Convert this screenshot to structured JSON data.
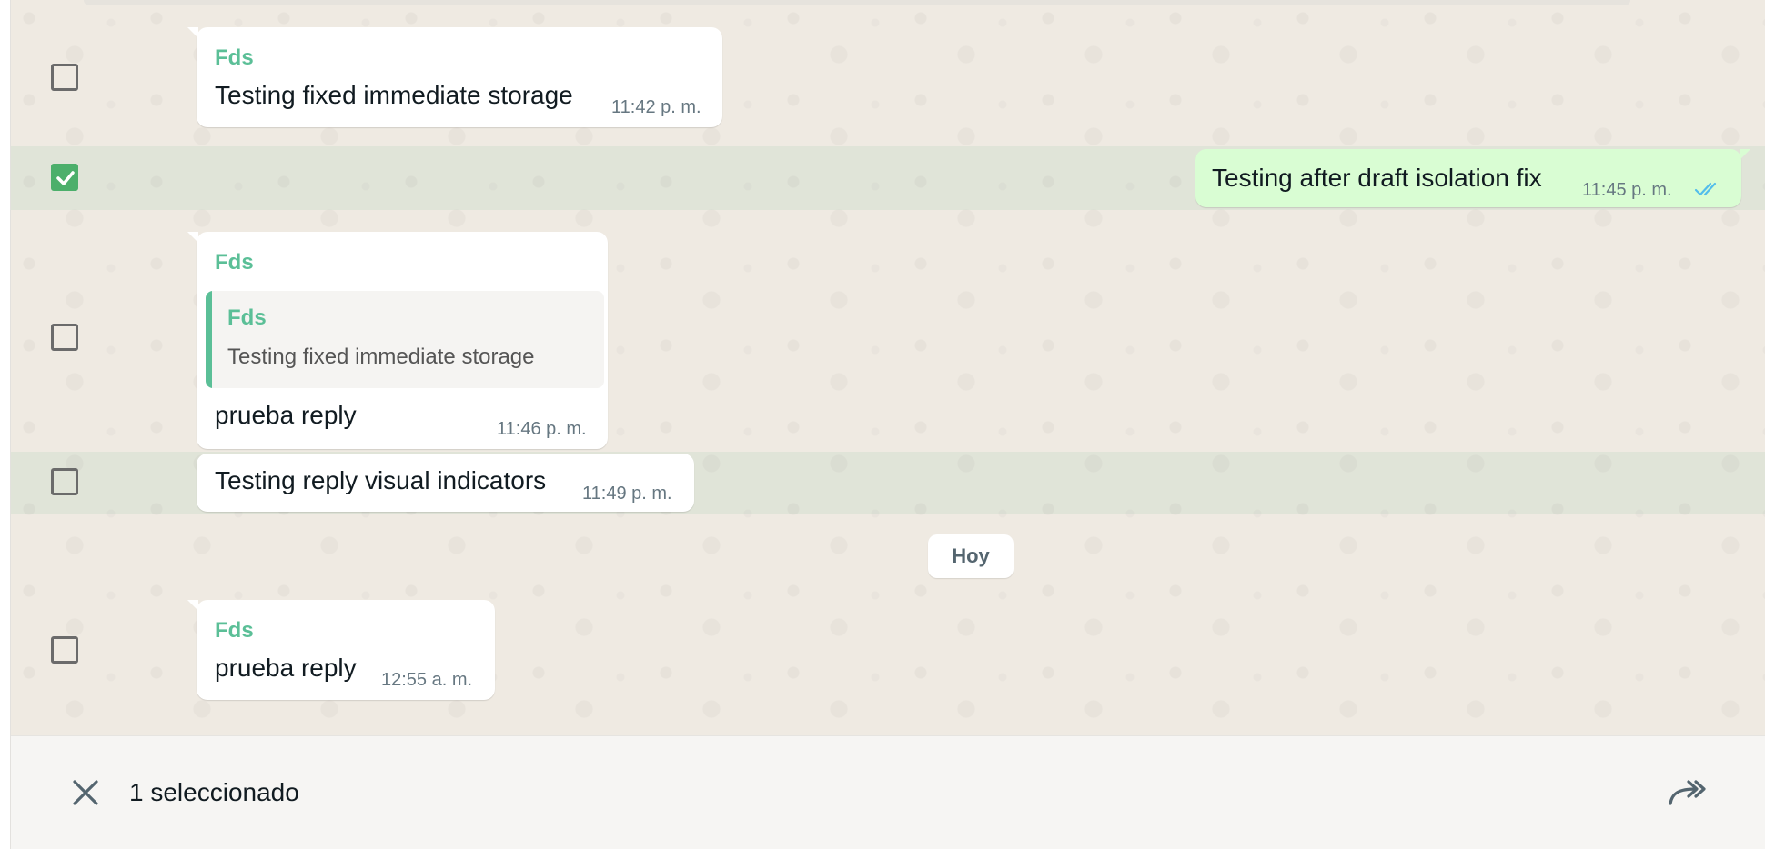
{
  "messages": [
    {
      "sender": "Fds",
      "text": "Testing fixed immediate storage",
      "time": "11:42 p. m.",
      "direction": "incoming",
      "selected": false
    },
    {
      "text": "Testing after draft isolation fix",
      "time": "11:45 p. m.",
      "direction": "outgoing",
      "status_icon": "double-check-read-icon",
      "selected": true
    },
    {
      "sender": "Fds",
      "quote": {
        "sender": "Fds",
        "text": "Testing fixed immediate storage"
      },
      "text": "prueba reply",
      "time": "11:46 p. m.",
      "direction": "incoming",
      "selected": false
    },
    {
      "text": "Testing reply visual indicators",
      "time": "11:49 p. m.",
      "direction": "incoming",
      "selected": false
    },
    {
      "sender": "Fds",
      "text": "prueba reply",
      "time": "12:55 a. m.",
      "direction": "incoming",
      "selected": false
    }
  ],
  "date_divider": "Hoy",
  "selection_bar": {
    "count_text": "1 seleccionado",
    "close_icon": "close-icon",
    "forward_icon": "forward-icon"
  },
  "colors": {
    "accent": "#5bbf97",
    "checkbox_checked": "#4caf6b",
    "outgoing_bubble": "#d9fdd3",
    "read_ticks": "#53bdeb",
    "chat_background": "#efeae2"
  }
}
